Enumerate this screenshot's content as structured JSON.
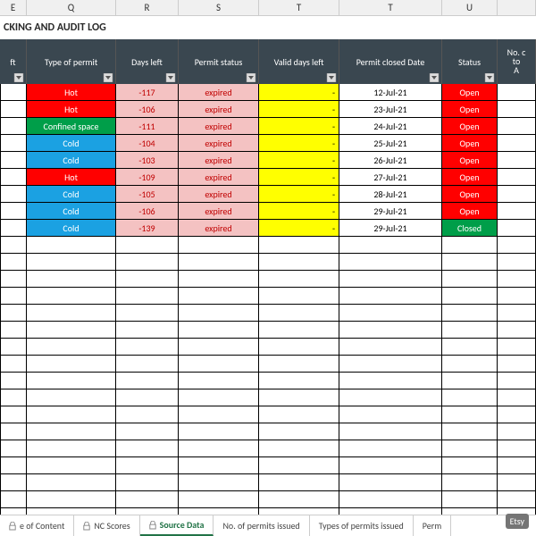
{
  "title": "CKING AND AUDIT LOG",
  "columns": [
    "E",
    "Q",
    "R",
    "S",
    "T",
    "T",
    "U",
    ""
  ],
  "headers": {
    "e": "ft",
    "q": "Type of permit",
    "r": "Days left",
    "s": "Permit status",
    "t1": "Valid days left",
    "t2": "Permit closed Date",
    "u": "Status",
    "v": "No. c\nto\nA"
  },
  "rows": [
    {
      "type": "Hot",
      "typeClass": "hot",
      "days": "-117",
      "status": "expired",
      "valid": "-",
      "closed": "12-Jul-21",
      "state": "Open",
      "stateClass": "open"
    },
    {
      "type": "Hot",
      "typeClass": "hot",
      "days": "-106",
      "status": "expired",
      "valid": "-",
      "closed": "23-Jul-21",
      "state": "Open",
      "stateClass": "open"
    },
    {
      "type": "Confined space",
      "typeClass": "confined",
      "days": "-111",
      "status": "expired",
      "valid": "-",
      "closed": "24-Jul-21",
      "state": "Open",
      "stateClass": "open"
    },
    {
      "type": "Cold",
      "typeClass": "cold",
      "days": "-104",
      "status": "expired",
      "valid": "-",
      "closed": "25-Jul-21",
      "state": "Open",
      "stateClass": "open"
    },
    {
      "type": "Cold",
      "typeClass": "cold",
      "days": "-103",
      "status": "expired",
      "valid": "-",
      "closed": "26-Jul-21",
      "state": "Open",
      "stateClass": "open"
    },
    {
      "type": "Hot",
      "typeClass": "hot",
      "days": "-109",
      "status": "expired",
      "valid": "-",
      "closed": "27-Jul-21",
      "state": "Open",
      "stateClass": "open"
    },
    {
      "type": "Cold",
      "typeClass": "cold",
      "days": "-105",
      "status": "expired",
      "valid": "-",
      "closed": "28-Jul-21",
      "state": "Open",
      "stateClass": "open"
    },
    {
      "type": "Cold",
      "typeClass": "cold",
      "days": "-106",
      "status": "expired",
      "valid": "-",
      "closed": "29-Jul-21",
      "state": "Open",
      "stateClass": "open"
    },
    {
      "type": "Cold",
      "typeClass": "cold",
      "days": "-139",
      "status": "expired",
      "valid": "-",
      "closed": "29-Jul-21",
      "state": "Closed",
      "stateClass": "closed"
    }
  ],
  "emptyRows": 17,
  "tabs": [
    {
      "label": "e of Content",
      "locked": true,
      "active": false
    },
    {
      "label": "NC Scores",
      "locked": true,
      "active": false
    },
    {
      "label": "Source Data",
      "locked": true,
      "active": true
    },
    {
      "label": "No. of permits issued",
      "locked": false,
      "active": false
    },
    {
      "label": "Types of permits issued",
      "locked": false,
      "active": false
    },
    {
      "label": "Perm",
      "locked": false,
      "active": false
    }
  ],
  "badge": "Etsy"
}
